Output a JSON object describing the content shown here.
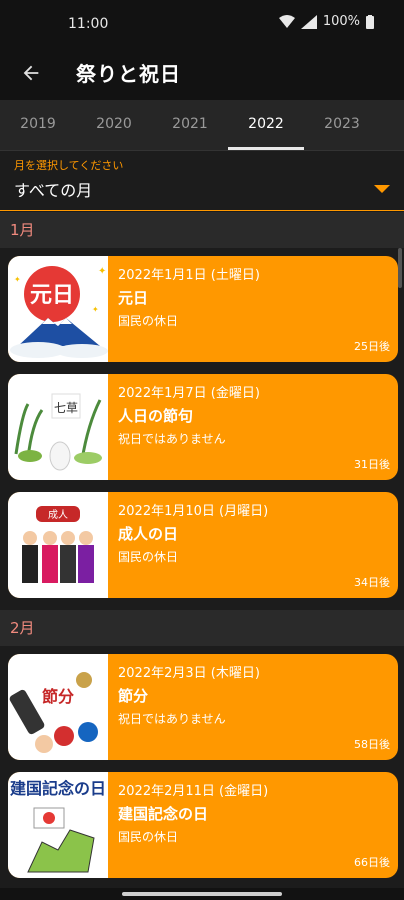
{
  "status": {
    "time": "11:00",
    "battery": "100%"
  },
  "app_bar": {
    "title": "祭りと祝日"
  },
  "tabs": [
    "2019",
    "2020",
    "2021",
    "2022",
    "2023"
  ],
  "selected_tab": "2022",
  "selector": {
    "label": "月を選択してください",
    "value": "すべての月"
  },
  "months": [
    {
      "label": "1月",
      "holidays": [
        {
          "date": "2022年1月1日 (土曜日)",
          "name": "元日",
          "type": "国民の休日",
          "days": "25日後"
        },
        {
          "date": "2022年1月7日 (金曜日)",
          "name": "人日の節句",
          "type": "祝日ではありません",
          "days": "31日後"
        },
        {
          "date": "2022年1月10日 (月曜日)",
          "name": "成人の日",
          "type": "国民の休日",
          "days": "34日後"
        }
      ]
    },
    {
      "label": "2月",
      "holidays": [
        {
          "date": "2022年2月3日 (木曜日)",
          "name": "節分",
          "type": "祝日ではありません",
          "days": "58日後"
        },
        {
          "date": "2022年2月11日 (金曜日)",
          "name": "建国記念の日",
          "type": "国民の休日",
          "days": "66日後"
        }
      ]
    }
  ],
  "image_texts": {
    "ganjitsu": "元日",
    "nanakusa": "七草",
    "seijin": "成人",
    "setsubun": "節分",
    "kenkoku": "建国記念の日"
  },
  "colors": {
    "accent": "#ff9800",
    "month_header": "#f08a7e",
    "background": "#1c1c1c"
  }
}
